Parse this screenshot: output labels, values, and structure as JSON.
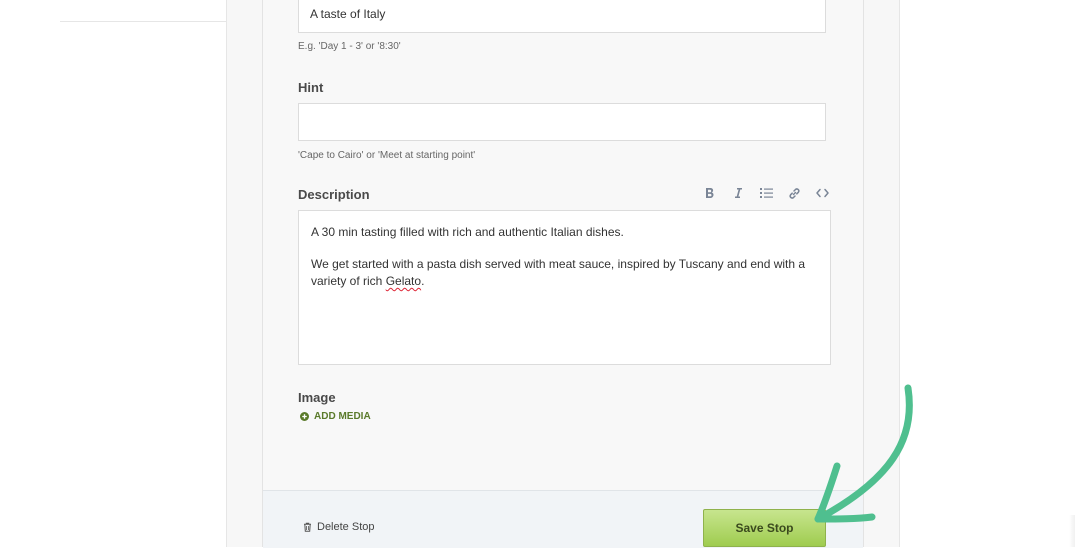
{
  "stop_form": {
    "title_value": "A taste of Italy",
    "title_helper": "E.g. 'Day 1 - 3' or '8:30'",
    "hint_label": "Hint",
    "hint_value": "",
    "hint_helper": "'Cape to Cairo' or 'Meet at starting point'",
    "description_label": "Description",
    "description_paragraph_1": "A 30 min tasting filled with rich and authentic Italian dishes.",
    "description_paragraph_2_prefix": "We get started with a pasta dish served with meat sauce, inspired by Tuscany and end with a variety of rich ",
    "description_paragraph_2_misspelled": "Gelato",
    "description_paragraph_2_suffix": ".",
    "image_label": "Image",
    "add_media_label": "ADD MEDIA"
  },
  "toolbar": {
    "buttons": [
      {
        "icon": "bold-icon"
      },
      {
        "icon": "italic-icon"
      },
      {
        "icon": "list-icon"
      },
      {
        "icon": "link-icon"
      },
      {
        "icon": "code-icon"
      }
    ]
  },
  "footer": {
    "delete_label": "Delete Stop",
    "save_label": "Save Stop"
  },
  "colors": {
    "save_button": "#a8d05f",
    "add_media_text": "#5a7a2a",
    "annotation_arrow": "#4fbf8f"
  }
}
